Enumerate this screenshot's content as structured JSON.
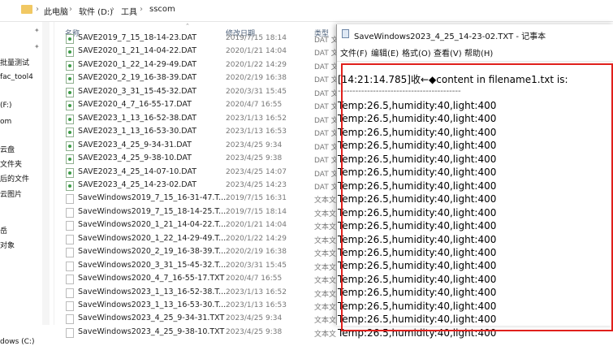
{
  "explorer": {
    "breadcrumb": [
      "此电脑",
      "软件 (D:)",
      "工具",
      "sscom"
    ],
    "columns": {
      "name": "名称",
      "date": "修改日期",
      "type": "类型"
    },
    "nav_items": [
      "批量测试",
      "fac_tool4",
      "(F:)",
      "om",
      "云盘",
      "文件夹",
      "后的文件",
      "云图片",
      "岳",
      "对象",
      "dows (C:)"
    ],
    "files": [
      {
        "name": "SAVE2019_7_15_18-14-23.DAT",
        "date": "2019/7/15 18:14",
        "type": "DAT 文",
        "kind": "dat"
      },
      {
        "name": "SAVE2020_1_21_14-04-22.DAT",
        "date": "2020/1/21 14:04",
        "type": "DAT 文",
        "kind": "dat"
      },
      {
        "name": "SAVE2020_1_22_14-29-49.DAT",
        "date": "2020/1/22 14:29",
        "type": "DAT 文",
        "kind": "dat"
      },
      {
        "name": "SAVE2020_2_19_16-38-39.DAT",
        "date": "2020/2/19 16:38",
        "type": "DAT 文",
        "kind": "dat"
      },
      {
        "name": "SAVE2020_3_31_15-45-32.DAT",
        "date": "2020/3/31 15:45",
        "type": "DAT 文",
        "kind": "dat"
      },
      {
        "name": "SAVE2020_4_7_16-55-17.DAT",
        "date": "2020/4/7 16:55",
        "type": "DAT 文",
        "kind": "dat"
      },
      {
        "name": "SAVE2023_1_13_16-52-38.DAT",
        "date": "2023/1/13 16:52",
        "type": "DAT 文",
        "kind": "dat"
      },
      {
        "name": "SAVE2023_1_13_16-53-30.DAT",
        "date": "2023/1/13 16:53",
        "type": "DAT 文",
        "kind": "dat"
      },
      {
        "name": "SAVE2023_4_25_9-34-31.DAT",
        "date": "2023/4/25 9:34",
        "type": "DAT 文",
        "kind": "dat"
      },
      {
        "name": "SAVE2023_4_25_9-38-10.DAT",
        "date": "2023/4/25 9:38",
        "type": "DAT 文",
        "kind": "dat"
      },
      {
        "name": "SAVE2023_4_25_14-07-10.DAT",
        "date": "2023/4/25 14:07",
        "type": "DAT 文",
        "kind": "dat"
      },
      {
        "name": "SAVE2023_4_25_14-23-02.DAT",
        "date": "2023/4/25 14:23",
        "type": "DAT 文",
        "kind": "dat"
      },
      {
        "name": "SaveWindows2019_7_15_16-31-47.T...",
        "date": "2019/7/15 16:31",
        "type": "文本文",
        "kind": "txt"
      },
      {
        "name": "SaveWindows2019_7_15_18-14-25.T...",
        "date": "2019/7/15 18:14",
        "type": "文本文",
        "kind": "txt"
      },
      {
        "name": "SaveWindows2020_1_21_14-04-22.T...",
        "date": "2020/1/21 14:04",
        "type": "文本文",
        "kind": "txt"
      },
      {
        "name": "SaveWindows2020_1_22_14-29-49.T...",
        "date": "2020/1/22 14:29",
        "type": "文本文",
        "kind": "txt"
      },
      {
        "name": "SaveWindows2020_2_19_16-38-39.T...",
        "date": "2020/2/19 16:38",
        "type": "文本文",
        "kind": "txt"
      },
      {
        "name": "SaveWindows2020_3_31_15-45-32.T...",
        "date": "2020/3/31 15:45",
        "type": "文本文",
        "kind": "txt"
      },
      {
        "name": "SaveWindows2020_4_7_16-55-17.TXT",
        "date": "2020/4/7 16:55",
        "type": "文本文",
        "kind": "txt"
      },
      {
        "name": "SaveWindows2023_1_13_16-52-38.T...",
        "date": "2023/1/13 16:52",
        "type": "文本文",
        "kind": "txt"
      },
      {
        "name": "SaveWindows2023_1_13_16-53-30.T...",
        "date": "2023/1/13 16:53",
        "type": "文本文",
        "kind": "txt"
      },
      {
        "name": "SaveWindows2023_4_25_9-34-31.TXT",
        "date": "2023/4/25 9:34",
        "type": "文本文",
        "kind": "txt"
      },
      {
        "name": "SaveWindows2023_4_25_9-38-10.TXT",
        "date": "2023/4/25 9:38",
        "type": "文本文",
        "kind": "txt"
      }
    ]
  },
  "notepad": {
    "title": "SaveWindows2023_4_25_14-23-02.TXT - 记事本",
    "menu": [
      "文件(F)",
      "编辑(E)",
      "格式(O)",
      "查看(V)",
      "帮助(H)"
    ],
    "content": [
      "[14:21:14.785]收←◆content in filename1.txt is:",
      "------------------------------------------",
      "Temp:26.5,humidity:40,light:400",
      "Temp:26.5,humidity:40,light:400",
      "Temp:26.5,humidity:40,light:400",
      "Temp:26.5,humidity:40,light:400",
      "Temp:26.5,humidity:40,light:400",
      "Temp:26.5,humidity:40,light:400",
      "Temp:26.5,humidity:40,light:400",
      "Temp:26.5,humidity:40,light:400",
      "Temp:26.5,humidity:40,light:400",
      "Temp:26.5,humidity:40,light:400",
      "Temp:26.5,humidity:40,light:400",
      "Temp:26.5,humidity:40,light:400",
      "Temp:26.5,humidity:40,light:400",
      "Temp:26.5,humidity:40,light:400",
      "Temp:26.5,humidity:40,light:400",
      "Temp:26.5,humidity:40,light:400",
      "Temp:26.5,humidity:40,light:400",
      "Temp:26.5,humidity:40,light:400"
    ]
  },
  "colors": {
    "highlight_box": "#e0201c",
    "folder": "#f1c863",
    "dat_icon": "#3c9a46"
  }
}
